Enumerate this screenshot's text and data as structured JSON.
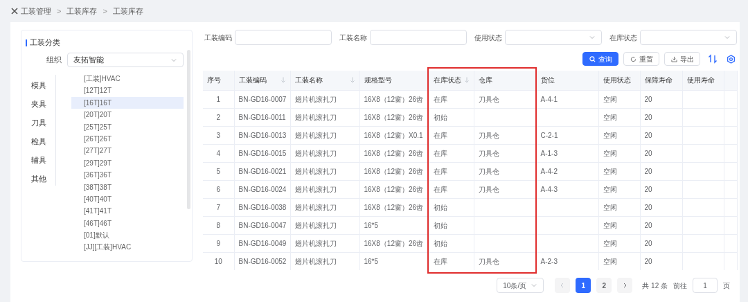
{
  "breadcrumb": {
    "items": [
      "工装管理",
      "工装库存",
      "工装库存"
    ],
    "separators": [
      ">",
      ">"
    ]
  },
  "sidebar": {
    "title": "工装分类",
    "org_label": "组织",
    "org_value": "友拓智能",
    "categories": [
      "模具",
      "夹具",
      "刀具",
      "检具",
      "辅具",
      "其他"
    ],
    "tree": [
      {
        "label": "[工装]HVAC",
        "selected": false
      },
      {
        "label": "[12T]12T",
        "selected": false
      },
      {
        "label": "[16T]16T",
        "selected": true
      },
      {
        "label": "[20T]20T",
        "selected": false
      },
      {
        "label": "[25T]25T",
        "selected": false
      },
      {
        "label": "[26T]26T",
        "selected": false
      },
      {
        "label": "[27T]27T",
        "selected": false
      },
      {
        "label": "[29T]29T",
        "selected": false
      },
      {
        "label": "[36T]36T",
        "selected": false
      },
      {
        "label": "[38T]38T",
        "selected": false
      },
      {
        "label": "[40T]40T",
        "selected": false
      },
      {
        "label": "[41T]41T",
        "selected": false
      },
      {
        "label": "[46T]46T",
        "selected": false
      },
      {
        "label": "[01]默认",
        "selected": false
      },
      {
        "label": "[JJ][工装]HVAC",
        "selected": false
      }
    ]
  },
  "filters": [
    {
      "label": "工装编码",
      "kind": "text"
    },
    {
      "label": "工装名称",
      "kind": "text"
    },
    {
      "label": "使用状态",
      "kind": "select"
    },
    {
      "label": "在库状态",
      "kind": "select"
    }
  ],
  "actions": [
    {
      "label": "查询",
      "kind": "primary"
    },
    {
      "label": "重置",
      "kind": "reset"
    },
    {
      "label": "导出",
      "kind": "export"
    }
  ],
  "table": {
    "columns": [
      {
        "label": "序号",
        "sortable": false,
        "highlighted": false
      },
      {
        "label": "工装编码",
        "sortable": true,
        "highlighted": false
      },
      {
        "label": "工装名称",
        "sortable": true,
        "highlighted": false
      },
      {
        "label": "规格型号",
        "sortable": false,
        "highlighted": false
      },
      {
        "label": "在库状态",
        "sortable": true,
        "highlighted": true
      },
      {
        "label": "仓库",
        "sortable": false,
        "highlighted": true
      },
      {
        "label": "货位",
        "sortable": false,
        "highlighted": false
      },
      {
        "label": "使用状态",
        "sortable": false,
        "highlighted": false
      },
      {
        "label": "保障寿命",
        "sortable": false,
        "highlighted": false
      },
      {
        "label": "使用寿命",
        "sortable": false,
        "highlighted": false
      },
      {
        "sortable": false,
        "highlighted": false
      }
    ],
    "rows": [
      [
        "1",
        "BN-GD16-0007",
        "翅片机滚扎刀",
        "16X8（12窗）26齿",
        "在库",
        "刀具仓",
        "A-4-1",
        "空闲",
        "20"
      ],
      [
        "2",
        "BN-GD16-0011",
        "翅片机滚扎刀",
        "16X8（12窗）26齿",
        "初始",
        "",
        "",
        "空闲",
        "20"
      ],
      [
        "3",
        "BN-GD16-0013",
        "翅片机滚扎刀",
        "16X8（12窗）X0.1",
        "在库",
        "刀具仓",
        "C-2-1",
        "空闲",
        "20"
      ],
      [
        "4",
        "BN-GD16-0015",
        "翅片机滚扎刀",
        "16X8（12窗）26齿",
        "在库",
        "刀具仓",
        "A-1-3",
        "空闲",
        "20"
      ],
      [
        "5",
        "BN-GD16-0021",
        "翅片机滚扎刀",
        "16X8（12窗）26齿",
        "在库",
        "刀具仓",
        "A-4-2",
        "空闲",
        "20"
      ],
      [
        "6",
        "BN-GD16-0024",
        "翅片机滚扎刀",
        "16X8（12窗）26齿",
        "在库",
        "刀具仓",
        "A-4-3",
        "空闲",
        "20"
      ],
      [
        "7",
        "BN-GD16-0038",
        "翅片机滚扎刀",
        "16X8（12窗）26齿",
        "初始",
        "",
        "",
        "空闲",
        "20"
      ],
      [
        "8",
        "BN-GD16-0047",
        "翅片机滚扎刀",
        "16*5",
        "初始",
        "",
        "",
        "空闲",
        "20"
      ],
      [
        "9",
        "BN-GD16-0049",
        "翅片机滚扎刀",
        "16X8（12窗）26齿",
        "初始",
        "",
        "",
        "空闲",
        "20"
      ],
      [
        "10",
        "BN-GD16-0052",
        "翅片机滚扎刀",
        "16*5",
        "在库",
        "刀具仓",
        "A-2-3",
        "空闲",
        "20"
      ]
    ]
  },
  "pagination": {
    "page_size": "10条/页",
    "pages": [
      {
        "label": "1",
        "selected": true
      },
      {
        "label": "2",
        "selected": false
      }
    ],
    "total": "共 12 条",
    "goto_label": "前往",
    "goto_value": "1",
    "goto_suffix": "页"
  }
}
